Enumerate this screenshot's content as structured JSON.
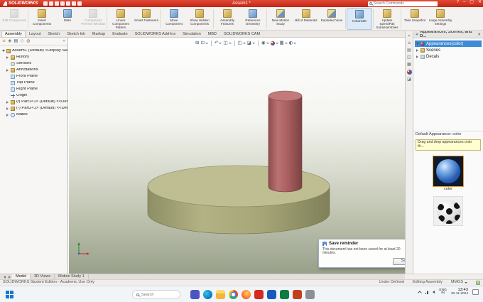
{
  "colors": {
    "titlebar_red": "#c9281a",
    "selection_blue": "#3d8ad6",
    "disc_top": "#bebe92",
    "disc_side": "#a3a376",
    "cylinder_body": "#ad5f5f",
    "cylinder_top": "#c27a7a",
    "hint_yellow": "#ffffcf",
    "thumb_selected_border": "#e8a020"
  },
  "titlebar": {
    "brand": "SOLIDWORKS",
    "doc_title": "Assem1 *",
    "search_placeholder": "Search Commands",
    "controls": {
      "help": "?",
      "minimize": "–",
      "maximize": "▢",
      "close": "✕"
    },
    "quick_access_icons": [
      "new-file",
      "open",
      "save",
      "print",
      "undo",
      "rebuild",
      "options"
    ]
  },
  "ribbon": {
    "buttons": [
      {
        "label": "Edit Component",
        "enabled": false
      },
      {
        "label": "Insert Components",
        "enabled": true
      },
      {
        "label": "Mate",
        "enabled": true
      },
      {
        "label": "Component Preview Window",
        "enabled": false
      },
      {
        "label": "Linear Component Pattern",
        "enabled": true
      },
      {
        "label": "Smart Fasteners",
        "enabled": true
      },
      {
        "label": "Move Component",
        "enabled": true
      },
      {
        "label": "Show Hidden Components",
        "enabled": true
      },
      {
        "label": "Assembly Features",
        "enabled": true
      },
      {
        "label": "Reference Geometry",
        "enabled": true
      },
      {
        "label": "New Motion Study",
        "enabled": true
      },
      {
        "label": "Bill of Materials",
        "enabled": true
      },
      {
        "label": "Exploded View",
        "enabled": true
      },
      {
        "label": "Instant3D",
        "enabled": true,
        "pressed": true
      },
      {
        "label": "Update SpeedPak Subassemblies",
        "enabled": true
      },
      {
        "label": "Take Snapshot",
        "enabled": true
      },
      {
        "label": "Large Assembly Settings",
        "enabled": true
      }
    ]
  },
  "command_tabs": [
    {
      "label": "Assembly",
      "active": true
    },
    {
      "label": "Layout",
      "active": false
    },
    {
      "label": "Sketch",
      "active": false
    },
    {
      "label": "Sketch Ink",
      "active": false
    },
    {
      "label": "Markup",
      "active": false
    },
    {
      "label": "Evaluate",
      "active": false
    },
    {
      "label": "SOLIDWORKS Add-Ins",
      "active": false
    },
    {
      "label": "Simulation",
      "active": false
    },
    {
      "label": "MBD",
      "active": false
    },
    {
      "label": "SOLIDWORKS CAM",
      "active": false
    }
  ],
  "feature_tree": {
    "panel_tab_icons": [
      "featuremanager",
      "propertymanager",
      "configurationmanager",
      "dimxpert",
      "displaymanager"
    ],
    "items": [
      {
        "label": "Assem1 (Default) <Display State",
        "icon": "assembly"
      },
      {
        "label": "History",
        "icon": "history-folder"
      },
      {
        "label": "Sensors",
        "icon": "sensors"
      },
      {
        "label": "Annotations",
        "icon": "annotations-folder"
      },
      {
        "label": "Front Plane",
        "icon": "plane"
      },
      {
        "label": "Top Plane",
        "icon": "plane"
      },
      {
        "label": "Right Plane",
        "icon": "plane"
      },
      {
        "label": "Origin",
        "icon": "origin"
      },
      {
        "label": "(f) Part1<1> (Default) <<Defa",
        "icon": "part"
      },
      {
        "label": "(-) Part2<1> (Default) <<Defa",
        "icon": "part"
      },
      {
        "label": "Mates",
        "icon": "mates"
      }
    ]
  },
  "viewport": {
    "headsup_icons": [
      "zoom-to-fit",
      "zoom-to-area",
      "previous-view",
      "section-view",
      "view-orientation",
      "display-style",
      "hide-show-items",
      "edit-appearance",
      "apply-scene",
      "view-settings"
    ]
  },
  "taskpane": {
    "title": "Appearances, Scenes, and D...",
    "side_icons": [
      "collapse-chevrons",
      "solidworks-resources",
      "design-library",
      "file-explorer",
      "view-palette",
      "appearances-scenes",
      "custom-properties"
    ],
    "tree": [
      {
        "label": "Appearances(color)",
        "selected": true
      },
      {
        "label": "Scenes",
        "selected": false
      },
      {
        "label": "Decals",
        "selected": false
      }
    ],
    "default_appearance": "Default Appearance: color",
    "hint": "Drag and drop appearances onto th...",
    "thumbnails": [
      {
        "label": "color",
        "icon": "blue-sphere-preview",
        "selected": true
      },
      {
        "label": "",
        "icon": "soccer-ball-preview",
        "selected": false
      }
    ]
  },
  "save_dialog": {
    "title": "Save reminder",
    "message": "This document has not been saved for at least 20 minutes.",
    "save_button": "Save"
  },
  "doc_tabs": [
    {
      "label": "Model",
      "active": true
    },
    {
      "label": "3D Views",
      "active": false
    },
    {
      "label": "Motion Study 1",
      "active": false
    }
  ],
  "statusbar": {
    "left": "SOLIDWORKS Student Edition - Academic Use Only",
    "constraint_status": "Under Defined",
    "mode": "Editing Assembly",
    "units": "MMGS"
  },
  "taskbar": {
    "search_label": "Search",
    "apps": [
      "teams",
      "edge",
      "file-explorer",
      "chrome",
      "firefox",
      "solidworks",
      "word",
      "excel",
      "powerpoint",
      "settings"
    ],
    "tray": {
      "language": "ENG",
      "region": "IN",
      "time": "13:43",
      "date": "30-11-2024"
    }
  }
}
